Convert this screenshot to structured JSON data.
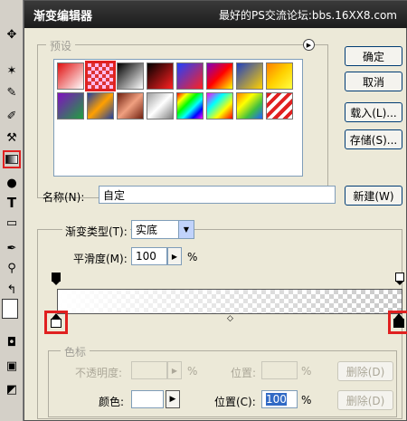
{
  "window": {
    "title": "渐变编辑器",
    "watermark": "最好的PS交流论坛:bbs.16XX8.com"
  },
  "toolbar": {
    "icons": [
      "move-icon",
      "magic-wand-icon",
      "brush-icon",
      "history-brush-icon",
      "gradient-icon",
      "burn-icon",
      "type-icon",
      "shape-icon",
      "eyedropper-icon",
      "zoom-icon"
    ]
  },
  "presets": {
    "label": "预设",
    "menu_icon": "circle-arrow-icon",
    "swatches": [
      {
        "bg": "linear-gradient(135deg,#e01010,#ffffff)"
      },
      {
        "bg": "repeating-conic-gradient(#d33 0% 25%, #fbe 0% 50%) 0 0/8px 8px",
        "selected": true
      },
      {
        "bg": "linear-gradient(135deg,#000,#fff)"
      },
      {
        "bg": "linear-gradient(135deg,#000,#ff2020)"
      },
      {
        "bg": "linear-gradient(135deg,#2040ff,#ff2020)"
      },
      {
        "bg": "linear-gradient(135deg,#8000c0,#ff0000,#ffff00)"
      },
      {
        "bg": "linear-gradient(135deg,#2040c0,#ffd000)"
      },
      {
        "bg": "linear-gradient(135deg,#ff8000,#ffd000,#ffff40)"
      },
      {
        "bg": "linear-gradient(135deg,#8010c0,#20a040)"
      },
      {
        "bg": "linear-gradient(135deg,#2040a0,#ffa000,#2040a0)"
      },
      {
        "bg": "linear-gradient(135deg,#702010,#f0a080,#702010)"
      },
      {
        "bg": "linear-gradient(135deg,#a0a0a0,#ffffff,#808080)"
      },
      {
        "bg": "linear-gradient(135deg,#ff0000,#ffff00,#00ff00,#00ffff,#0000ff,#ff00ff)"
      },
      {
        "bg": "linear-gradient(135deg,#ff00ff,#00ffff,#ffff00,#ff0000)"
      },
      {
        "bg": "linear-gradient(135deg,#ff8000,#ffff00,#40c040,#2060ff)"
      },
      {
        "bg": "repeating-linear-gradient(135deg,#e02020 0 4px,#ffffff 4px 8px)"
      }
    ]
  },
  "buttons": {
    "ok": "确定",
    "cancel": "取消",
    "load": "载入(L)...",
    "save": "存储(S)...",
    "new": "新建(W)",
    "delete_opacity": "删除(D)",
    "delete_color": "删除(D)"
  },
  "name_field": {
    "label": "名称(N):",
    "value": "自定"
  },
  "gradient_type": {
    "label": "渐变类型(T):",
    "value": "实底"
  },
  "smoothness": {
    "label": "平滑度(M):",
    "value": "100",
    "unit": "%"
  },
  "stops_group": {
    "label": "色标",
    "opacity_label": "不透明度:",
    "opacity_value": "",
    "opacity_unit": "%",
    "location_label": "位置:",
    "location_unit": "%",
    "color_label": "颜色:",
    "color_swatch": "#ffffff",
    "color_location_label": "位置(C):",
    "color_location_value": "100",
    "color_location_unit": "%"
  }
}
